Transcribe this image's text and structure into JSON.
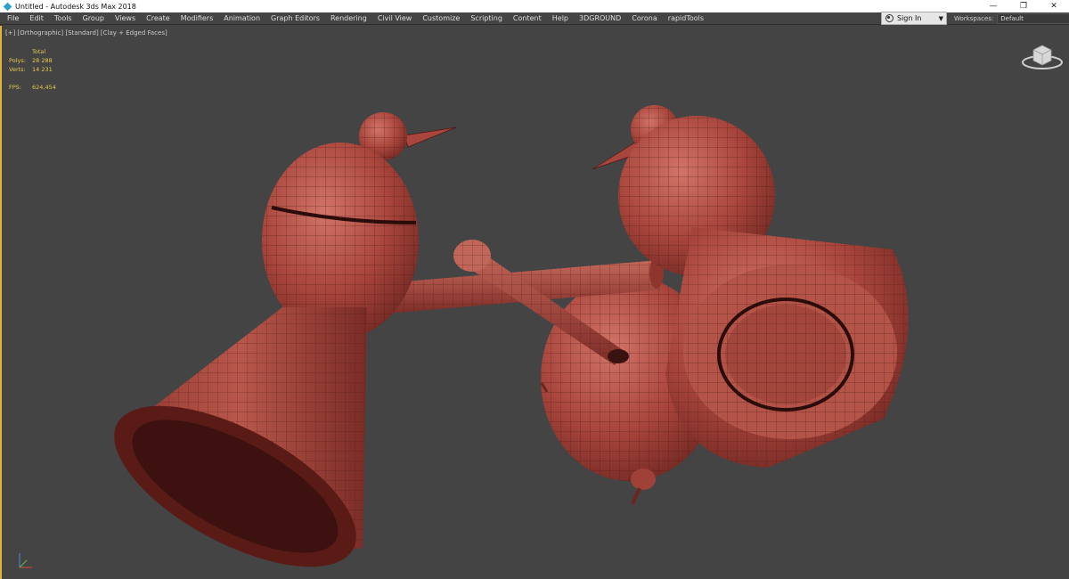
{
  "window": {
    "title": "Untitled - Autodesk 3ds Max 2018",
    "controls": {
      "minimize": "—",
      "restore": "❐",
      "close": "✕"
    }
  },
  "menu": {
    "items": [
      "File",
      "Edit",
      "Tools",
      "Group",
      "Views",
      "Create",
      "Modifiers",
      "Animation",
      "Graph Editors",
      "Rendering",
      "Civil View",
      "Customize",
      "Scripting",
      "Content",
      "Help",
      "3DGROUND",
      "Corona",
      "rapidTools"
    ],
    "sign_in": "Sign In",
    "workspaces_label": "Workspaces:",
    "workspace_value": "Default"
  },
  "viewport": {
    "label": "[+] [Orthographic] [Standard] [Clay + Edged Faces]",
    "stats": {
      "header": "Total",
      "polys_label": "Polys:",
      "polys_value": "28 288",
      "verts_label": "Verts:",
      "verts_value": "14 231",
      "fps_label": "FPS:",
      "fps_value": "624,454"
    },
    "viewcube_icon": "viewcube-icon",
    "axis_icon": "axis-tripod-icon"
  },
  "colors": {
    "viewport_bg": "#444444",
    "model_clay": "#a8453c",
    "wire": "#4a1714",
    "stats_text": "#e6c84a",
    "active_border": "#e0b43a"
  }
}
